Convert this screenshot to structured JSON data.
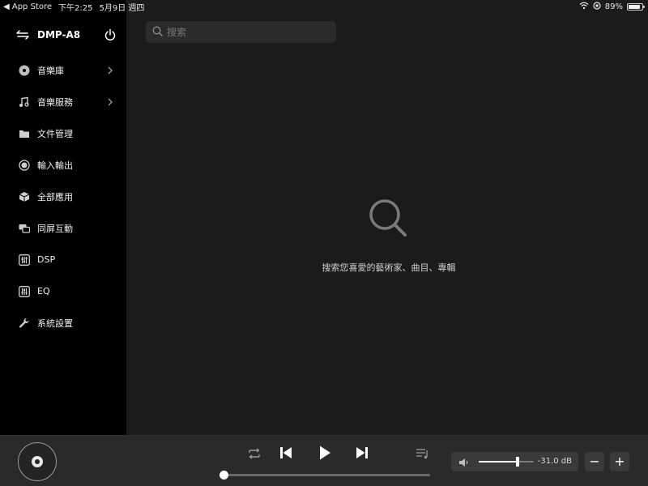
{
  "status_bar": {
    "back_app": "◀ App Store",
    "time": "下午2:25",
    "date": "5月9日 週四",
    "battery": "89%",
    "battery_level": 0.89
  },
  "sidebar": {
    "device_name": "DMP-A8",
    "items": [
      {
        "label": "音樂庫",
        "icon": "disc-icon",
        "has_chevron": true
      },
      {
        "label": "音樂服務",
        "icon": "music-note-icon",
        "has_chevron": true
      },
      {
        "label": "文件管理",
        "icon": "folder-icon",
        "has_chevron": false
      },
      {
        "label": "輸入輸出",
        "icon": "radio-icon",
        "has_chevron": false
      },
      {
        "label": "全部應用",
        "icon": "cube-icon",
        "has_chevron": false
      },
      {
        "label": "同屏互動",
        "icon": "screen-mirror-icon",
        "has_chevron": false
      },
      {
        "label": "DSP",
        "icon": "equalizer-grid-icon",
        "has_chevron": false
      },
      {
        "label": "EQ",
        "icon": "equalizer-grid-icon",
        "has_chevron": false
      },
      {
        "label": "系統設置",
        "icon": "wrench-icon",
        "has_chevron": false
      }
    ]
  },
  "search": {
    "placeholder": "搜索",
    "value": ""
  },
  "empty_state": {
    "message": "搜索您喜愛的藝術家、曲目、專輯"
  },
  "player": {
    "progress": 0.0,
    "volume_level": 0.7,
    "volume_readout": "-31.0 dB",
    "minus_label": "−",
    "plus_label": "+"
  },
  "colors": {
    "background": "#1b1b1b",
    "sidebar": "#000000",
    "player_bar": "#2a2a2a",
    "accent": "#ffffff"
  }
}
